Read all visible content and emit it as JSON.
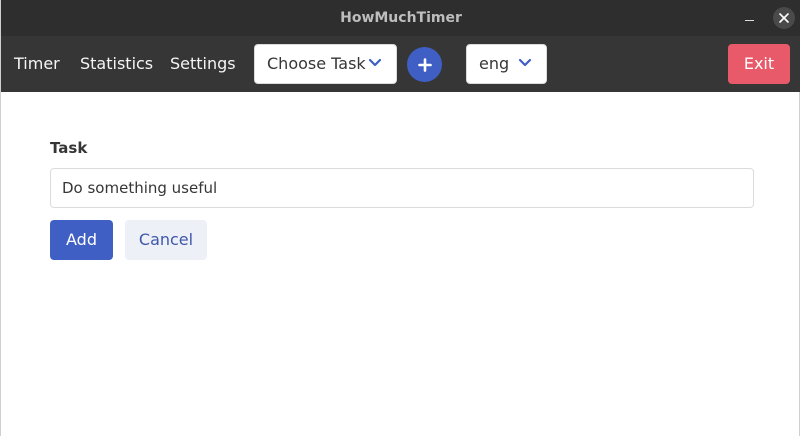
{
  "window": {
    "title": "HowMuchTimer"
  },
  "nav": {
    "timer_label": "Timer",
    "statistics_label": "Statistics",
    "settings_label": "Settings",
    "task_select_value": "Choose Task",
    "language_select_value": "eng",
    "exit_label": "Exit"
  },
  "form": {
    "task_label": "Task",
    "task_value": "Do something useful",
    "add_label": "Add",
    "cancel_label": "Cancel"
  },
  "icons": {
    "minimize": "minimize-icon",
    "close": "close-icon",
    "chevron": "chevron-down-icon",
    "plus": "plus-icon"
  },
  "colors": {
    "titlebar": "#2e2e2e",
    "navbar": "#363636",
    "primary": "#3f5fc4",
    "danger": "#e85a6a",
    "light": "#eef0f7"
  }
}
